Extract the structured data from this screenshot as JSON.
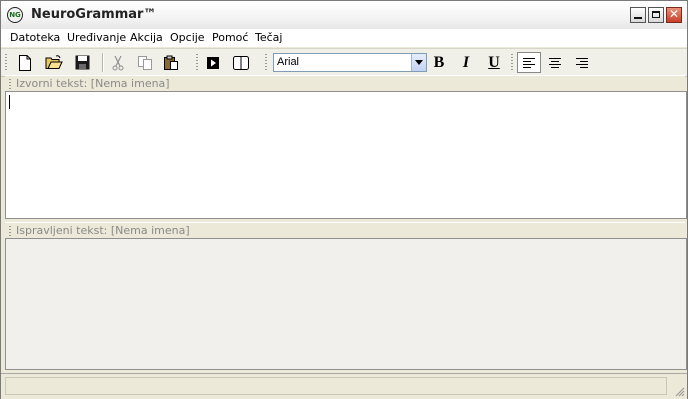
{
  "window": {
    "title": "NeuroGrammar™",
    "icon_text": "NG",
    "icon": "neurogrammar-logo-icon"
  },
  "menu": [
    "Datoteka",
    "Uređivanje",
    "Akcija",
    "Opcije",
    "Pomoć",
    "Tečaj"
  ],
  "toolbar": {
    "buttons": [
      "new-document-icon",
      "open-folder-icon",
      "save-icon",
      "cut-icon",
      "copy-icon",
      "paste-icon",
      "run-check-icon",
      "split-view-icon"
    ],
    "font": "Arial",
    "bold": "B",
    "italic": "I",
    "underline": "U",
    "align_buttons": [
      "align-left-icon",
      "align-center-icon",
      "align-right-icon"
    ],
    "active_align": "left"
  },
  "source_pane": {
    "header": "Izvorni tekst: [Nema imena]",
    "text": ""
  },
  "corrected_pane": {
    "header": "Ispravljeni tekst: [Nema imena]",
    "text": ""
  },
  "status": {
    "text": ""
  },
  "colors": {
    "face": "#ece9d8",
    "editor_bg": "#ffffff",
    "corrected_bg": "#f1f0ec",
    "header_text": "#8a8a8a"
  }
}
